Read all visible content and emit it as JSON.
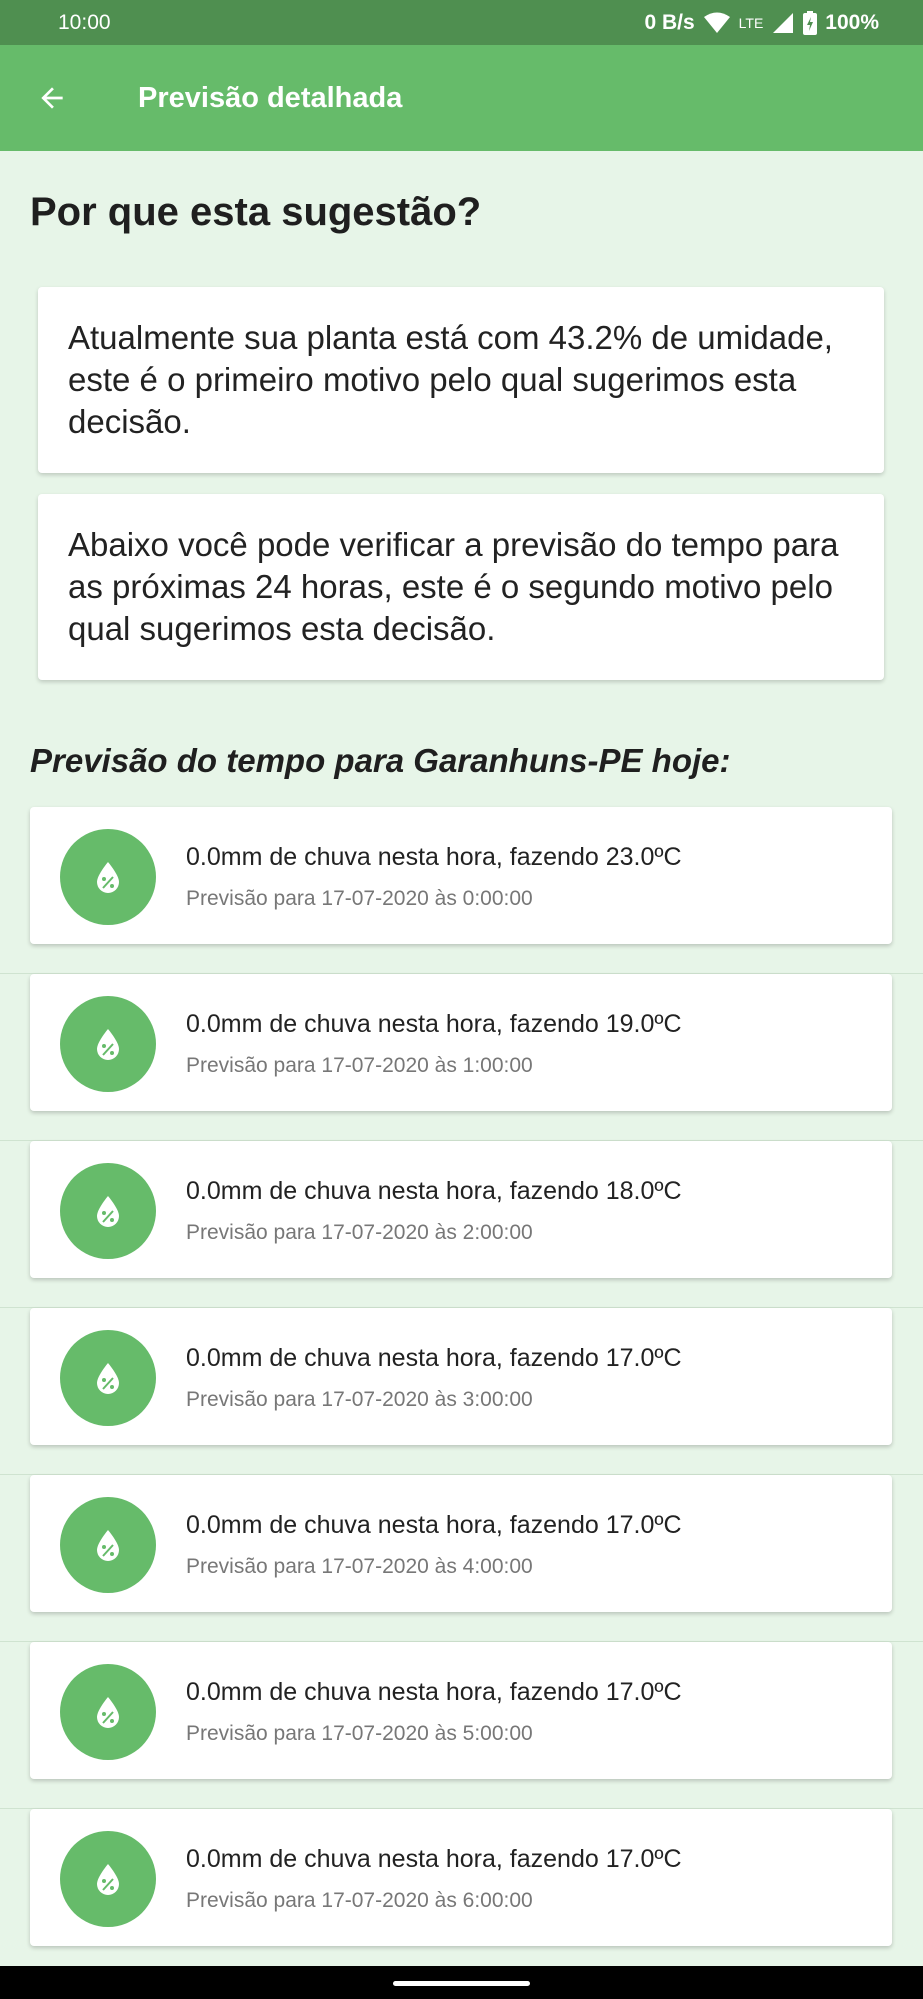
{
  "status_bar": {
    "time": "10:00",
    "data_rate": "0 B/s",
    "network": "LTE",
    "battery": "100%"
  },
  "app_bar": {
    "title": "Previsão detalhada",
    "back_icon": "arrow-back-icon"
  },
  "heading": "Por que esta sugestão?",
  "reasons": [
    "Atualmente sua planta está com 43.2% de umidade, este é o primeiro motivo pelo qual sugerimos esta decisão.",
    "Abaixo você pode verificar a previsão do tempo para as próximas 24 horas, este é o segundo motivo pelo qual sugerimos esta decisão."
  ],
  "forecast_title": "Previsão do tempo para Garanhuns-PE hoje:",
  "forecast": [
    {
      "main": "0.0mm de chuva nesta hora, fazendo 23.0ºC",
      "sub": "Previsão para 17-07-2020 às 0:00:00"
    },
    {
      "main": "0.0mm de chuva nesta hora, fazendo 19.0ºC",
      "sub": "Previsão para 17-07-2020 às 1:00:00"
    },
    {
      "main": "0.0mm de chuva nesta hora, fazendo 18.0ºC",
      "sub": "Previsão para 17-07-2020 às 2:00:00"
    },
    {
      "main": "0.0mm de chuva nesta hora, fazendo 17.0ºC",
      "sub": "Previsão para 17-07-2020 às 3:00:00"
    },
    {
      "main": "0.0mm de chuva nesta hora, fazendo 17.0ºC",
      "sub": "Previsão para 17-07-2020 às 4:00:00"
    },
    {
      "main": "0.0mm de chuva nesta hora, fazendo 17.0ºC",
      "sub": "Previsão para 17-07-2020 às 5:00:00"
    },
    {
      "main": "0.0mm de chuva nesta hora, fazendo 17.0ºC",
      "sub": "Previsão para 17-07-2020 às 6:00:00"
    }
  ],
  "colors": {
    "primary": "#66bb6a",
    "primary_dark": "#4f8f50",
    "background": "#e7f5e8"
  },
  "icons": {
    "forecast_item": "water-drop-percent-icon"
  }
}
